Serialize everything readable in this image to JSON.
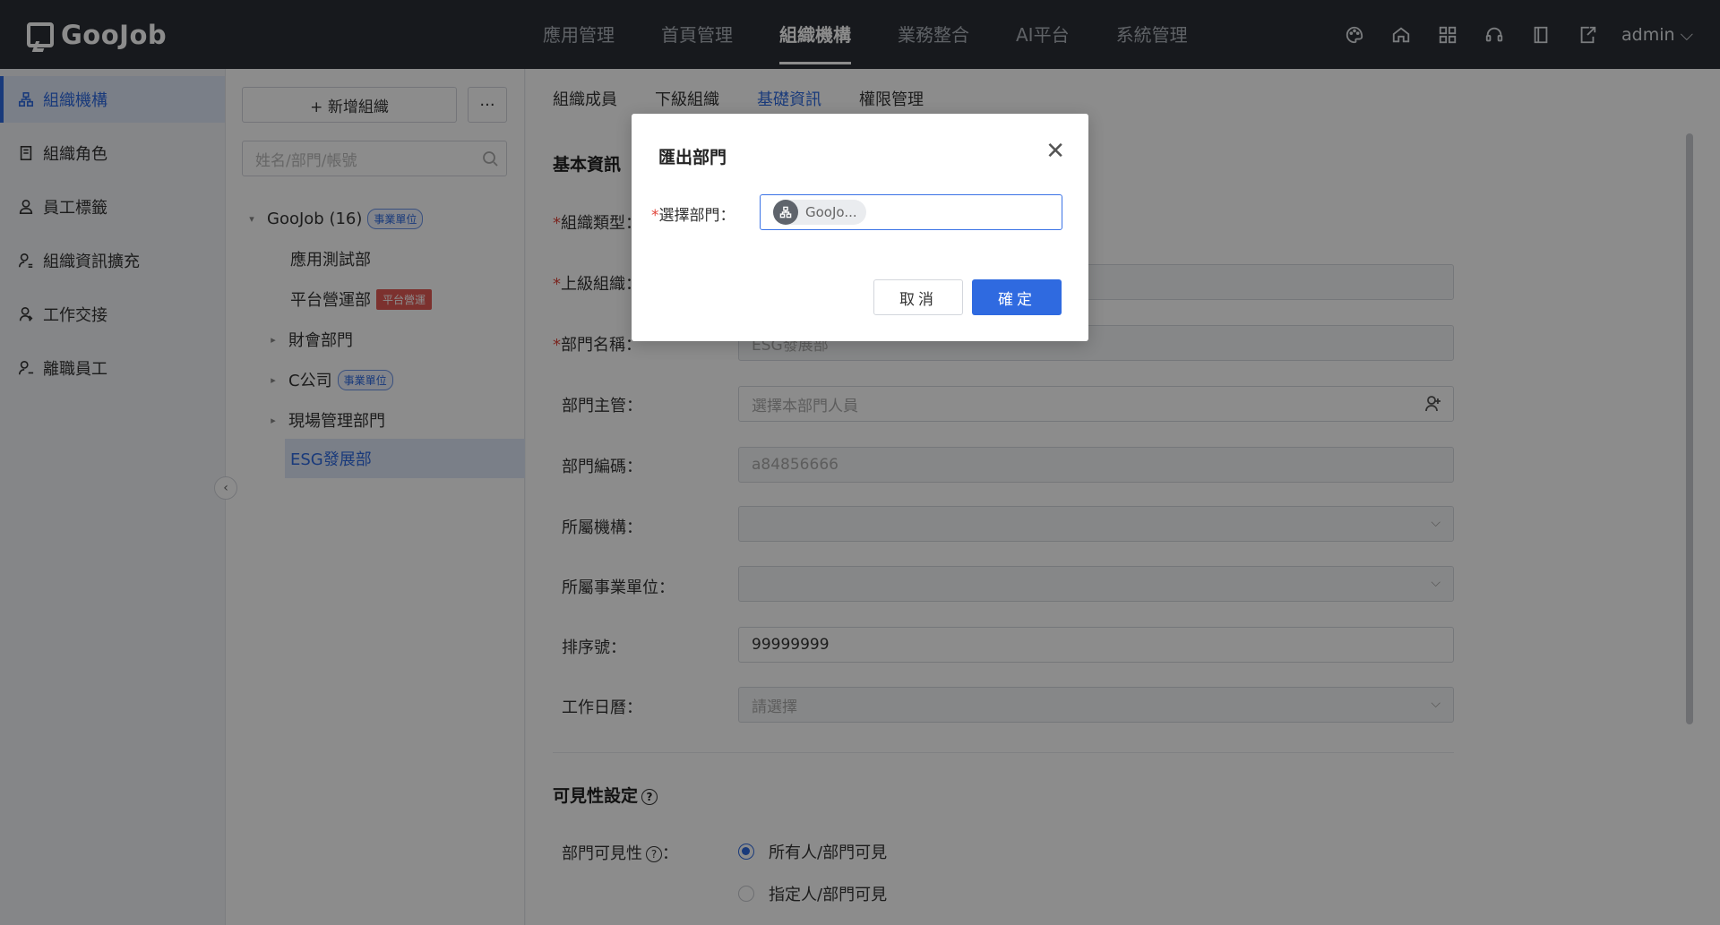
{
  "brand": {
    "name": "GooJob"
  },
  "nav": {
    "items": [
      "應用管理",
      "首頁管理",
      "組織機構",
      "業務整合",
      "AI平台",
      "系統管理"
    ],
    "active": "組織機構"
  },
  "header_tools": {
    "icons": [
      "palette-icon",
      "home-icon",
      "apps-icon",
      "support-icon",
      "book-icon",
      "export-icon"
    ],
    "user": "admin"
  },
  "sidebar": {
    "items": [
      {
        "label": "組織機構",
        "icon": "org-icon",
        "active": true
      },
      {
        "label": "組織角色",
        "icon": "role-icon"
      },
      {
        "label": "員工標籤",
        "icon": "tag-icon"
      },
      {
        "label": "組織資訊擴充",
        "icon": "user-extend-icon"
      },
      {
        "label": "工作交接",
        "icon": "handover-icon"
      },
      {
        "label": "離職員工",
        "icon": "resign-icon"
      }
    ]
  },
  "tree_panel": {
    "add_button": "+ 新增組織",
    "more_button": "···",
    "search_placeholder": "姓名/部門/帳號",
    "nodes": [
      {
        "label": "GooJob (16)",
        "badge": "事業單位",
        "caret": "▾"
      },
      {
        "label": "應用測試部"
      },
      {
        "label": "平台營運部",
        "badge": "平台營運"
      },
      {
        "label": "財會部門",
        "caret": "▸"
      },
      {
        "label": "C公司",
        "badge": "事業單位",
        "caret": "▸"
      },
      {
        "label": "現場管理部門",
        "caret": "▸"
      },
      {
        "label": "ESG發展部"
      }
    ]
  },
  "main": {
    "tabs": [
      "組織成員",
      "下級組織",
      "基礎資訊",
      "權限管理"
    ],
    "active_tab": "基礎資訊",
    "basic_title": "基本資訊",
    "fields": {
      "org_type": "組織類型：",
      "parent_org": "上級組織：",
      "dept_name": "部門名稱：",
      "dept_name_value": "ESG發展部",
      "manager": "部門主管：",
      "manager_placeholder": "選擇本部門人員",
      "code": "部門編碼：",
      "code_value": "a84856666",
      "institution": "所屬機構：",
      "business_unit": "所屬事業單位：",
      "sort": "排序號：",
      "sort_value": "99999999",
      "calendar": "工作日曆：",
      "calendar_placeholder": "請選擇"
    },
    "visibility": {
      "title": "可見性設定",
      "label": "部門可見性",
      "option_all": "所有人/部門可見",
      "option_specific": "指定人/部門可見"
    }
  },
  "modal": {
    "title": "匯出部門",
    "label": "選擇部門：",
    "chip": "GooJo...",
    "cancel": "取消",
    "ok": "確定"
  },
  "colors": {
    "accent": "#2f6ae0",
    "topbar": "#2b2f36",
    "required": "#e0463b"
  }
}
